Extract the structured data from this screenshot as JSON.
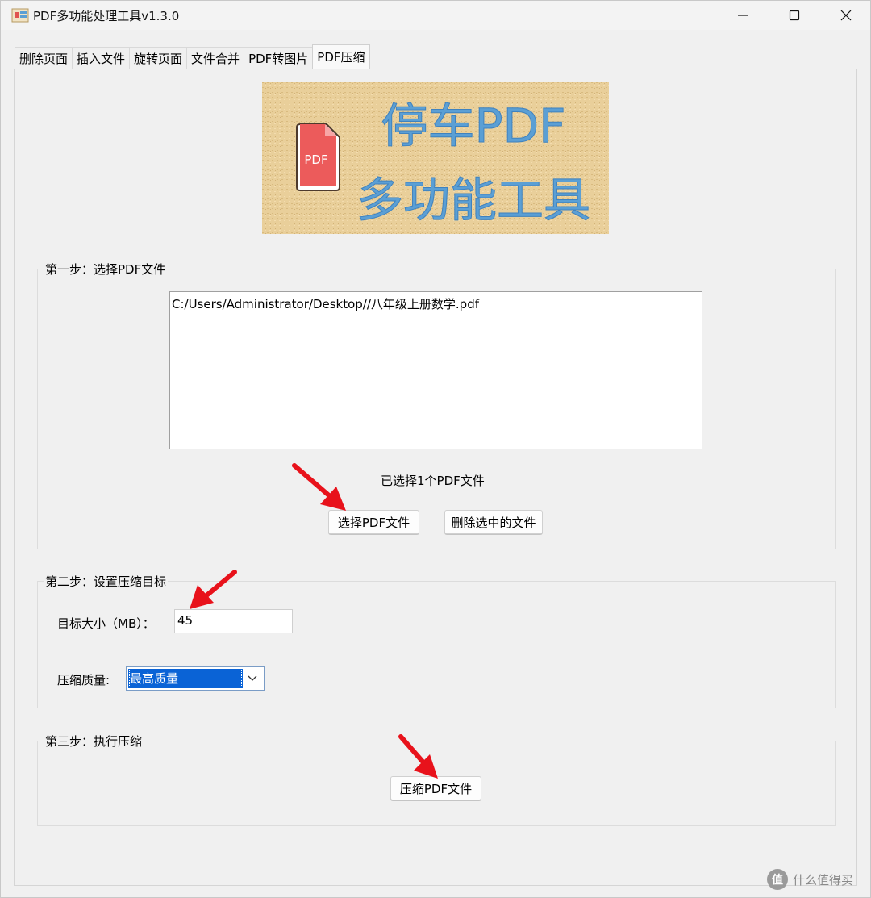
{
  "window": {
    "title": "PDF多功能处理工具v1.3.0"
  },
  "tabs": [
    {
      "label": "删除页面"
    },
    {
      "label": "插入文件"
    },
    {
      "label": "旋转页面"
    },
    {
      "label": "文件合并"
    },
    {
      "label": "PDF转图片"
    },
    {
      "label": "PDF压缩",
      "active": true
    }
  ],
  "banner": {
    "line1": "停车PDF",
    "line2": "多功能工具",
    "doc_icon_text": "PDF"
  },
  "step1": {
    "title": "第一步：选择PDF文件",
    "files": [
      "C:/Users/Administrator/Desktop//八年级上册数学.pdf"
    ],
    "status": "已选择1个PDF文件",
    "select_button": "选择PDF文件",
    "delete_button": "删除选中的文件"
  },
  "step2": {
    "title": "第二步：设置压缩目标",
    "size_label": "目标大小（MB）：",
    "size_value": "45",
    "quality_label": "压缩质量:",
    "quality_value": "最高质量"
  },
  "step3": {
    "title": "第三步：执行压缩",
    "compress_button": "压缩PDF文件"
  },
  "watermark": {
    "badge": "值",
    "text": "什么值得买"
  },
  "colors": {
    "accent": "#0a63d6",
    "arrow": "#e8121b",
    "banner_text": "#5b9fd4"
  }
}
